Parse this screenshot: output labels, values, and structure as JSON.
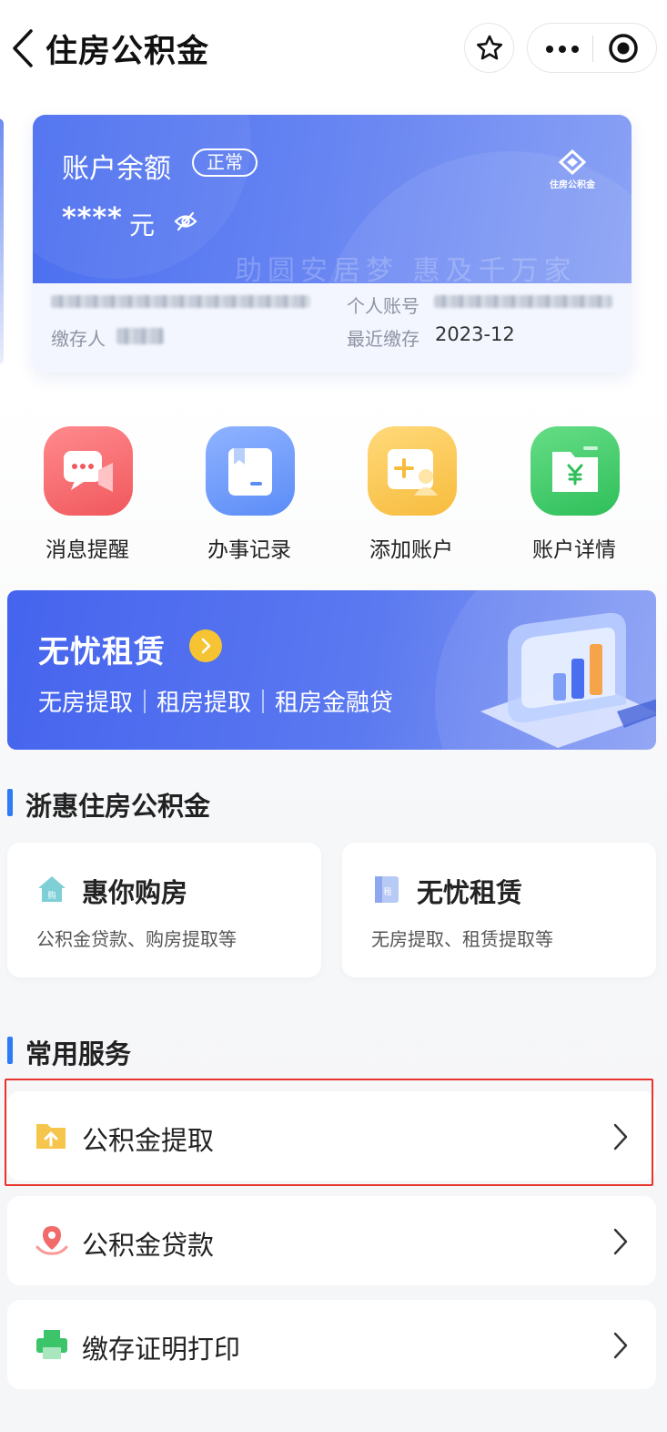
{
  "header": {
    "title": "住房公积金"
  },
  "balance_card": {
    "label": "账户余额",
    "status_badge": "正常",
    "amount_masked": "****",
    "unit": "元",
    "logo_text": "住房公积金",
    "slogan": "助圆安居梦 惠及千万家",
    "depositor_label": "缴存人",
    "account_label": "个人账号",
    "recent_deposit_label": "最近缴存",
    "recent_deposit_value": "2023-12"
  },
  "quick_actions": [
    {
      "label": "消息提醒",
      "color": "#f0585d"
    },
    {
      "label": "办事记录",
      "color": "#5b8cf7"
    },
    {
      "label": "添加账户",
      "color": "#f7bc3d"
    },
    {
      "label": "账户详情",
      "color": "#37c763"
    }
  ],
  "banner": {
    "title": "无忧租赁",
    "subtitle": "无房提取｜租房提取｜租房金融贷"
  },
  "section_zhehui": {
    "title": "浙惠住房公积金",
    "cards": [
      {
        "title": "惠你购房",
        "subtitle": "公积金贷款、购房提取等",
        "icon_char": "购"
      },
      {
        "title": "无忧租赁",
        "subtitle": "无房提取、租赁提取等",
        "icon_char": "租"
      }
    ]
  },
  "section_common": {
    "title": "常用服务",
    "items": [
      {
        "label": "公积金提取"
      },
      {
        "label": "公积金贷款"
      },
      {
        "label": "缴存证明打印"
      }
    ]
  },
  "colors": {
    "accent": "#2e7bf6",
    "card_blue": "#4a6ef0",
    "highlight_red": "#e8322c"
  }
}
